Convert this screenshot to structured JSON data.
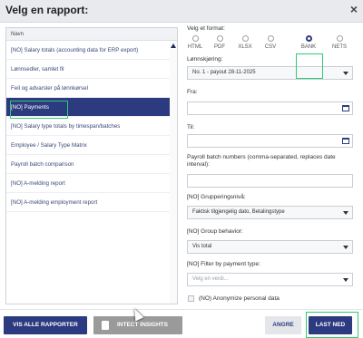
{
  "dialog": {
    "title": "Velg en rapport:",
    "close_glyph": "×"
  },
  "report_list": {
    "header": "Navn",
    "items": [
      {
        "label": "[NO] Salary totals (accounting data for ERP export)",
        "selected": false
      },
      {
        "label": "Lønnsedler, samlet fil",
        "selected": false
      },
      {
        "label": "Feil og advarsler på lønnkørsel",
        "selected": false
      },
      {
        "label": "[NO] Payments",
        "selected": true
      },
      {
        "label": "[NO] Salary type totals by timespan/batches",
        "selected": false
      },
      {
        "label": "Employee / Salary Type Matrix",
        "selected": false
      },
      {
        "label": "Payroll batch comparison",
        "selected": false
      },
      {
        "label": "[NO] A-melding report",
        "selected": false
      },
      {
        "label": "[NO] A-melding employment report",
        "selected": false
      }
    ]
  },
  "form": {
    "format_label": "Velg et format:",
    "formats": [
      "HTML",
      "PDF",
      "XLSX",
      "CSV",
      "BANK",
      "NETS"
    ],
    "selected_format": "BANK",
    "payroll_run_label": "Lønnskjøring:",
    "payroll_run_value": "No. 1 - payout 28-11-2025",
    "from_label": "Fra:",
    "to_label": "Til:",
    "batch_numbers_label": "Payroll batch numbers (comma-separated, replaces date interval):",
    "grouping_label": "[NO] Grupperingsnivå:",
    "grouping_value": "Faktisk tilgjengelig dato, Betalingstype",
    "group_behavior_label": "[NO] Group behavior:",
    "group_behavior_value": "Vis total",
    "filter_label": "[NO] Filter by payment type:",
    "filter_placeholder": "Velg en verdi...",
    "anonymize_label": "(NO) Anonymize personal data"
  },
  "footer": {
    "show_all_label": "VIS ALLE RAPPORTER",
    "insights_label": "INTECT INSIGHTS",
    "cancel_label": "ANGRE",
    "download_label": "LAST NED"
  },
  "colors": {
    "primary": "#2c3a7f",
    "highlight": "#2ecc71",
    "titlebar": "#e8eaee"
  }
}
